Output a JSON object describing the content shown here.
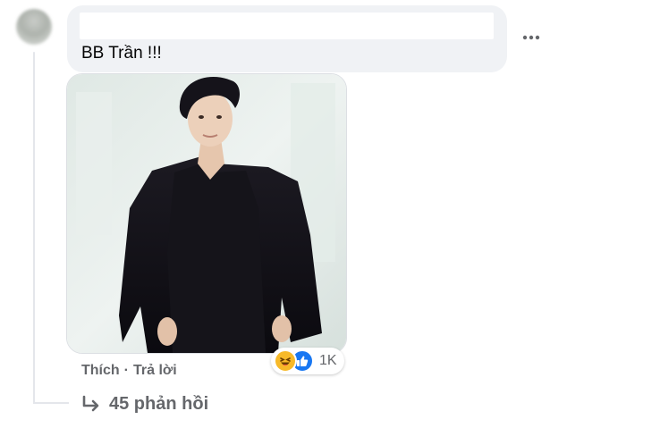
{
  "comment": {
    "text": "BB Trần !!!",
    "more_icon": "ellipsis-icon",
    "photo_alt": "BB Trần"
  },
  "actions": {
    "like_label": "Thích",
    "separator": "·",
    "reply_label": "Trả lời"
  },
  "reactions": {
    "icons": [
      "haha-icon",
      "like-icon"
    ],
    "count": "1K",
    "colors": {
      "haha": "#f7b928",
      "like": "#1877f2"
    }
  },
  "replies": {
    "label": "45 phản hồi",
    "icon": "reply-arrow-icon"
  },
  "colors": {
    "bubble": "#f0f2f5",
    "secondary_text": "#65676b"
  }
}
